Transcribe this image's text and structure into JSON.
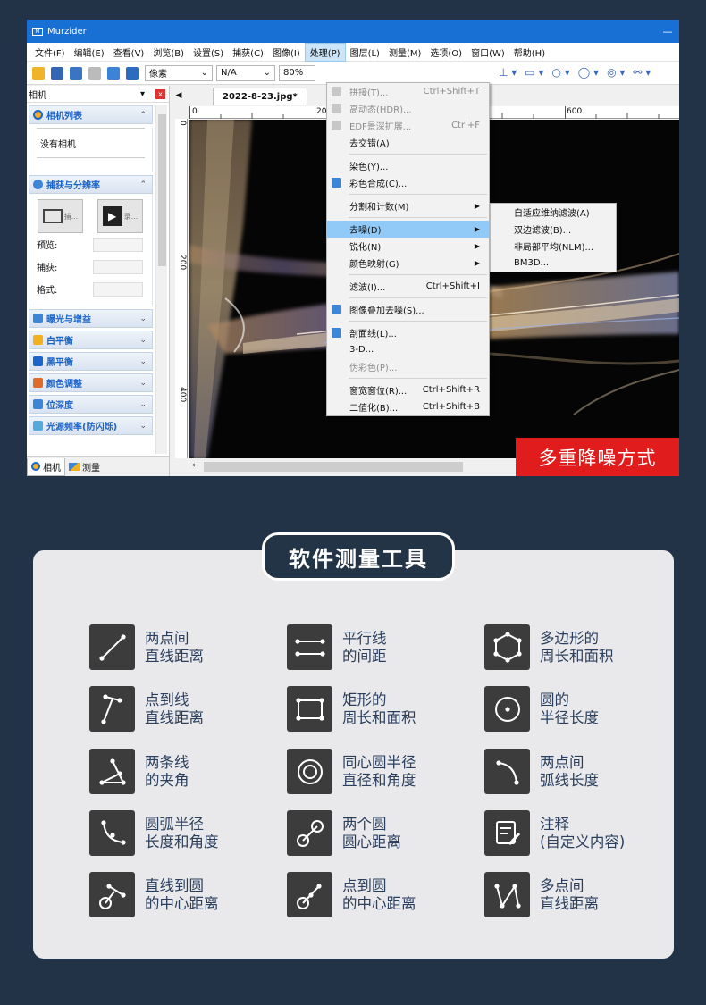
{
  "window": {
    "title": "Murzider",
    "logo": "M",
    "minimize": "—",
    "close": "✕"
  },
  "menubar": [
    "文件(F)",
    "编辑(E)",
    "查看(V)",
    "浏览(B)",
    "设置(S)",
    "捕获(C)",
    "图像(I)",
    "处理(P)",
    "图层(L)",
    "测量(M)",
    "选项(O)",
    "窗口(W)",
    "帮助(H)"
  ],
  "toolbar": {
    "unit": "像素",
    "mode": "N/A",
    "zoom": "80%"
  },
  "left_panel": {
    "header": "相机",
    "pin": "▾",
    "close": "x",
    "camera_list": {
      "title": "相机列表",
      "empty": "没有相机"
    },
    "capture": {
      "title": "捕获与分辨率",
      "rows": [
        "预览:",
        "捕获:",
        "格式:"
      ],
      "btn1_label": "捕...",
      "btn2_label": "录..."
    },
    "sections": [
      "曝光与增益",
      "白平衡",
      "黑平衡",
      "颜色调整",
      "位深度",
      "光源频率(防闪烁)"
    ],
    "tabs": [
      "相机",
      "测量"
    ]
  },
  "document": {
    "tab": "2022-8-23.jpg*",
    "ruler_top": [
      "0",
      "20",
      "600"
    ],
    "ruler_left": [
      "0",
      "200",
      "400"
    ],
    "badge": "多重降噪方式"
  },
  "process_menu": [
    {
      "label": "拼接(T)...",
      "shortcut": "Ctrl+Shift+T",
      "disabled": true,
      "icon": "stitch-icon"
    },
    {
      "label": "高动态(HDR)...",
      "disabled": true,
      "icon": "hdr-icon"
    },
    {
      "label": "EDF景深扩展...",
      "shortcut": "Ctrl+F",
      "disabled": true,
      "icon": "edf-icon"
    },
    {
      "label": "去交错(A)"
    },
    {
      "sep": true
    },
    {
      "label": "染色(Y)..."
    },
    {
      "label": "彩色合成(C)...",
      "icon": "color-composite-icon"
    },
    {
      "sep": true
    },
    {
      "label": "分割和计数(M)",
      "submenu": true
    },
    {
      "sep": true
    },
    {
      "label": "去噪(D)",
      "submenu": true,
      "highlight": true
    },
    {
      "label": "锐化(N)",
      "submenu": true
    },
    {
      "label": "颜色映射(G)",
      "submenu": true
    },
    {
      "sep": true
    },
    {
      "label": "滤波(I)...",
      "shortcut": "Ctrl+Shift+I"
    },
    {
      "sep": true
    },
    {
      "label": "图像叠加去噪(S)...",
      "icon": "stack-denoise-icon"
    },
    {
      "sep": true
    },
    {
      "label": "剖面线(L)...",
      "icon": "profile-icon"
    },
    {
      "label": "3-D..."
    },
    {
      "label": "伪彩色(P)...",
      "disabled": true
    },
    {
      "sep": true
    },
    {
      "label": "窗宽窗位(R)...",
      "shortcut": "Ctrl+Shift+R"
    },
    {
      "label": "二值化(B)...",
      "shortcut": "Ctrl+Shift+B"
    }
  ],
  "denoise_submenu": [
    "自适应维纳滤波(A)",
    "双边滤波(B)...",
    "非局部平均(NLM)...",
    "BM3D..."
  ],
  "tools_section": {
    "title": "软件测量工具",
    "tools": [
      {
        "line1": "两点间",
        "line2": "直线距离",
        "icon": "two-point-line-icon"
      },
      {
        "line1": "平行线",
        "line2": "的间距",
        "icon": "parallel-lines-icon"
      },
      {
        "line1": "多边形的",
        "line2": "周长和面积",
        "icon": "polygon-icon"
      },
      {
        "line1": "点到线",
        "line2": "直线距离",
        "icon": "point-to-line-icon"
      },
      {
        "line1": "矩形的",
        "line2": "周长和面积",
        "icon": "rectangle-icon"
      },
      {
        "line1": "圆的",
        "line2": "半径长度",
        "icon": "circle-radius-icon"
      },
      {
        "line1": "两条线",
        "line2": "的夹角",
        "icon": "angle-icon"
      },
      {
        "line1": "同心圆半径",
        "line2": "直径和角度",
        "icon": "concentric-circle-icon"
      },
      {
        "line1": "两点间",
        "line2": "弧线长度",
        "icon": "arc-length-icon"
      },
      {
        "line1": "圆弧半径",
        "line2": "长度和角度",
        "icon": "arc-radius-icon"
      },
      {
        "line1": "两个圆",
        "line2": "圆心距离",
        "icon": "two-circles-icon"
      },
      {
        "line1": "注释",
        "line2": "(自定义内容)",
        "icon": "annotation-icon"
      },
      {
        "line1": "直线到圆",
        "line2": "的中心距离",
        "icon": "line-to-circle-icon"
      },
      {
        "line1": "点到圆",
        "line2": "的中心距离",
        "icon": "point-to-circle-icon"
      },
      {
        "line1": "多点间",
        "line2": "直线距离",
        "icon": "multi-point-icon"
      }
    ]
  },
  "colors": {
    "background": "#233347",
    "titlebar": "#1870d4",
    "accent_blue": "#1b64c8",
    "badge_red": "#e01c1c",
    "card_bg": "#e9e9eb",
    "tool_text": "#2b3f5e"
  }
}
